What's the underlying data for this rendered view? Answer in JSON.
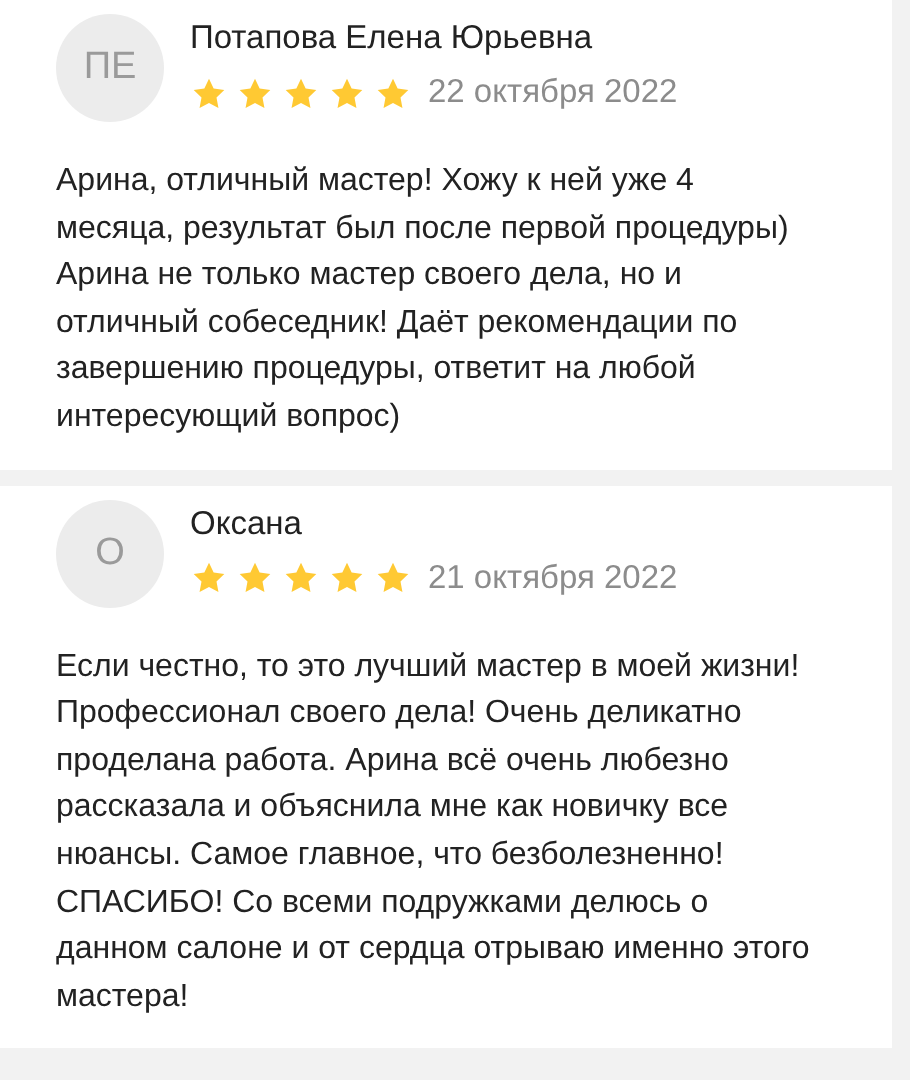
{
  "reviews": [
    {
      "avatar": "ПЕ",
      "name": "Потапова Елена Юрьевна",
      "stars": 5,
      "date": "22 октября 2022",
      "text": "Арина, отличный мастер! Хожу к ней уже 4 месяца, результат был после первой процедуры) Арина не только мастер своего дела, но и отличный собеседник! Даёт рекомендации по завершению процедуры, ответит на любой интересующий вопрос)"
    },
    {
      "avatar": "О",
      "name": "Оксана",
      "stars": 5,
      "date": "21 октября 2022",
      "text": "Если честно, то это лучший мастер в моей жизни! Профессионал своего дела! Очень деликатно проделана работа. Арина всё очень любезно рассказала и объяснила мне как новичку все нюансы. Самое главное, что безболезненно! СПАСИБО! Со всеми подружками делюсь о данном салоне и от сердца отрываю именно этого мастера!"
    }
  ]
}
